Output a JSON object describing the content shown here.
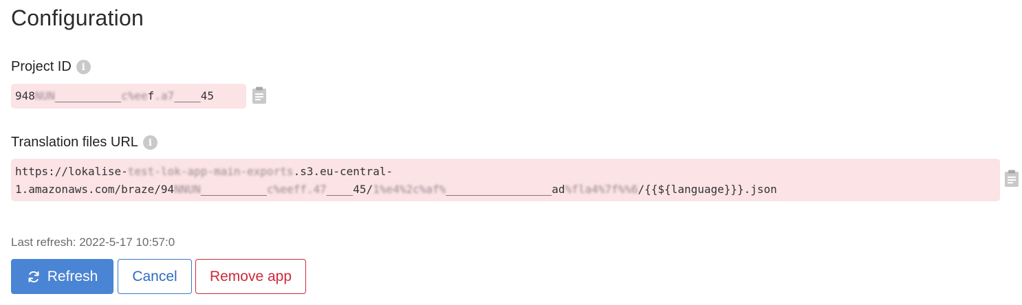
{
  "page": {
    "title": "Configuration"
  },
  "project_id": {
    "label": "Project ID",
    "value_prefix": "948",
    "value_blur1": "NUN",
    "value_mid": "__________",
    "value_blur2": "c%ee",
    "value_mid2": "f",
    "value_blur3": ".a7",
    "value_mid3": "____",
    "value_suffix": "45"
  },
  "translation_url": {
    "label": "Translation files URL",
    "line1_prefix": "https://lokalise-",
    "line1_blur": "test-lok-app-main-exports",
    "line1_suffix": ".s3.eu-central-",
    "line2_prefix": "1.amazonaws.com/braze/94",
    "line2_blur1": "NNUN",
    "line2_mid1": "__________",
    "line2_blur2": "c%eeff.47",
    "line2_mid2": "____45/",
    "line2_blur3": "1%e4%2c%af%",
    "line2_mid3": "________________ad",
    "line2_blur4": "%fla4%7f%%6",
    "line2_suffix": "/{{${language}}}.json"
  },
  "status": {
    "last_refresh": "Last refresh: 2022-5-17 10:57:0"
  },
  "buttons": {
    "refresh": "Refresh",
    "cancel": "Cancel",
    "remove": "Remove app"
  },
  "icons": {
    "info": "info-icon",
    "clipboard": "clipboard-icon",
    "refresh": "refresh-icon"
  },
  "colors": {
    "primary": "#4a84d4",
    "danger": "#cc2a3a",
    "code_bg": "#fbe3e6"
  }
}
